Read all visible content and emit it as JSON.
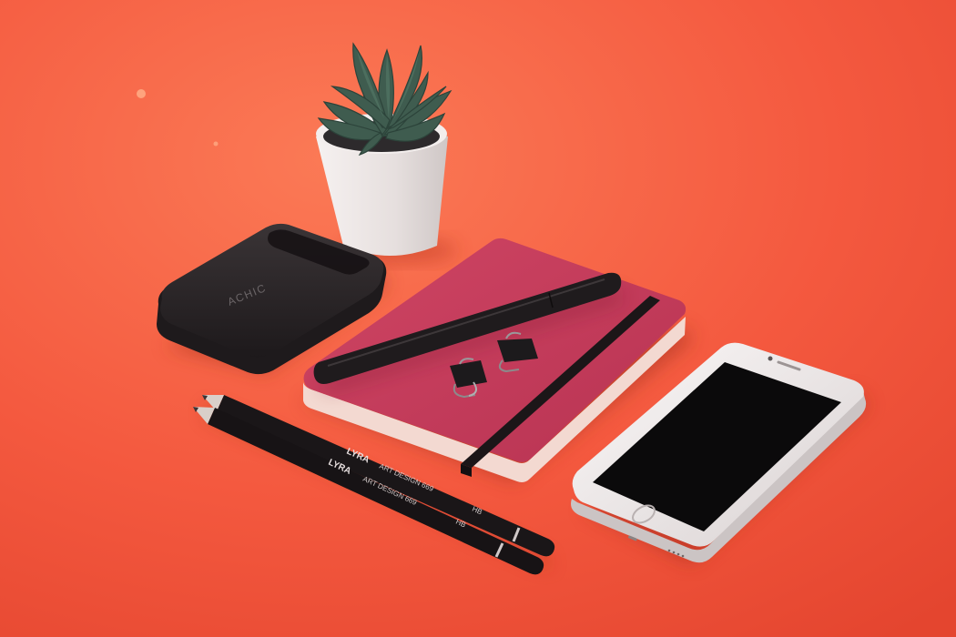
{
  "scene": {
    "background": "#f2583e",
    "background_light": "#fb7452",
    "background_dark": "#e2462f"
  },
  "power_bank": {
    "brand_text": "ACHIC",
    "color": "#2a2426"
  },
  "plant_pot": {
    "pot_color": "#ebe6e5",
    "leaf_color": "#3d5a4d"
  },
  "notebook": {
    "cover_color": "#c53b58",
    "edge_color": "#f3d7cf",
    "strap_color": "#1c1618"
  },
  "pen": {
    "color": "#1e1a1c"
  },
  "binder_clips": {
    "count": 2,
    "color": "#1c1a1c"
  },
  "pencils": {
    "color": "#1a1618",
    "imprint_brand": "LYRA",
    "imprint_text": "ART DESIGN 669",
    "grade": "HB",
    "count": 2
  },
  "smartphone": {
    "body_color": "#f1ecec",
    "screen_color": "#0b0a0b"
  }
}
